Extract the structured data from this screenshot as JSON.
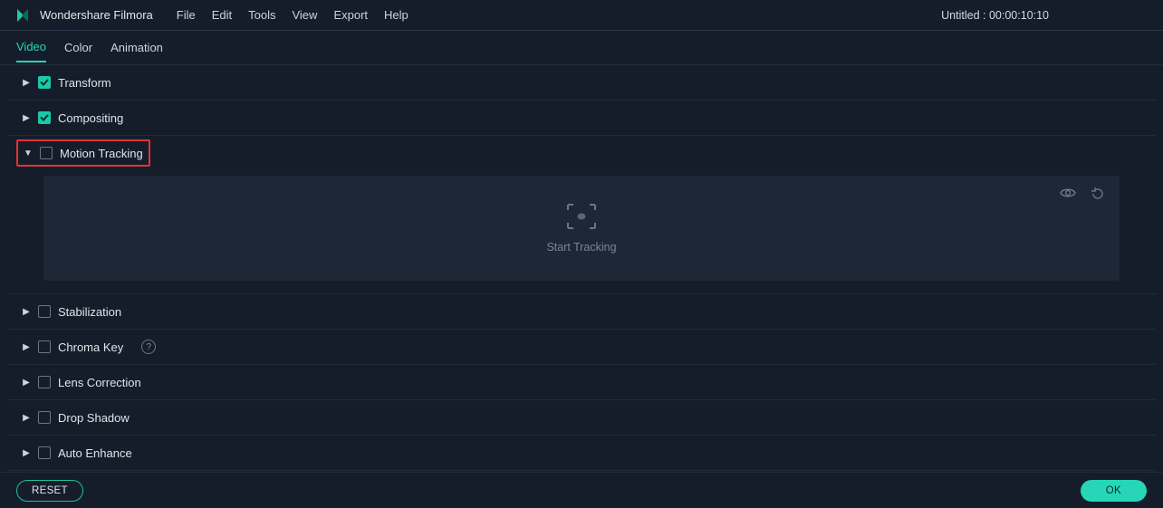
{
  "app": {
    "title": "Wondershare Filmora",
    "menus": [
      "File",
      "Edit",
      "Tools",
      "View",
      "Export",
      "Help"
    ],
    "document_title": "Untitled : 00:00:10:10"
  },
  "tabs": {
    "items": [
      "Video",
      "Color",
      "Animation"
    ],
    "active_index": 0
  },
  "sections": [
    {
      "label": "Transform",
      "expanded": false,
      "checked": true,
      "highlighted": false,
      "has_help": false
    },
    {
      "label": "Compositing",
      "expanded": false,
      "checked": true,
      "highlighted": false,
      "has_help": false
    },
    {
      "label": "Motion Tracking",
      "expanded": true,
      "checked": false,
      "highlighted": true,
      "has_help": false
    },
    {
      "label": "Stabilization",
      "expanded": false,
      "checked": false,
      "highlighted": false,
      "has_help": false
    },
    {
      "label": "Chroma Key",
      "expanded": false,
      "checked": false,
      "highlighted": false,
      "has_help": true
    },
    {
      "label": "Lens Correction",
      "expanded": false,
      "checked": false,
      "highlighted": false,
      "has_help": false
    },
    {
      "label": "Drop Shadow",
      "expanded": false,
      "checked": false,
      "highlighted": false,
      "has_help": false
    },
    {
      "label": "Auto Enhance",
      "expanded": false,
      "checked": false,
      "highlighted": false,
      "has_help": false
    }
  ],
  "motion_tracking": {
    "start_label": "Start Tracking"
  },
  "footer": {
    "reset": "RESET",
    "ok": "OK"
  },
  "icons": {
    "logo": "filmora-logo-icon",
    "eye": "eye-icon",
    "reset_circle": "reset-icon",
    "focus": "tracking-target-icon",
    "help": "help-icon"
  }
}
